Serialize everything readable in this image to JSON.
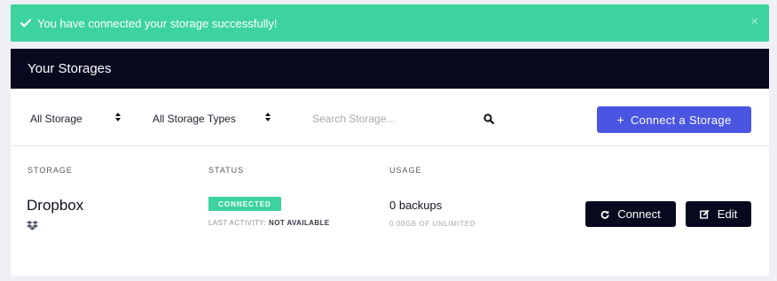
{
  "alert": {
    "message": "You have connected your storage successfully!",
    "close_glyph": "×",
    "color": "#3dd39f"
  },
  "header": {
    "title": "Your Storages",
    "background": "#08081f"
  },
  "toolbar": {
    "storage_filter": {
      "value": "All Storage"
    },
    "type_filter": {
      "value": "All Storage Types"
    },
    "search": {
      "placeholder": "Search Storage...",
      "icon": "search-icon"
    },
    "connect_button": {
      "label": "Connect a Storage",
      "plus": "+",
      "color": "#4a55e2"
    }
  },
  "table": {
    "columns": [
      "STORAGE",
      "STATUS",
      "USAGE"
    ],
    "rows": [
      {
        "name": "Dropbox",
        "icon": "dropbox-icon",
        "status": "CONNECTED",
        "last_activity_label": "LAST ACTIVITY:",
        "last_activity_value": "NOT AVAILABLE",
        "usage": "0 backups",
        "usage_detail": "0.00GB OF UNLIMITED",
        "actions": {
          "connect_label": "Connect",
          "edit_label": "Edit"
        }
      }
    ]
  }
}
